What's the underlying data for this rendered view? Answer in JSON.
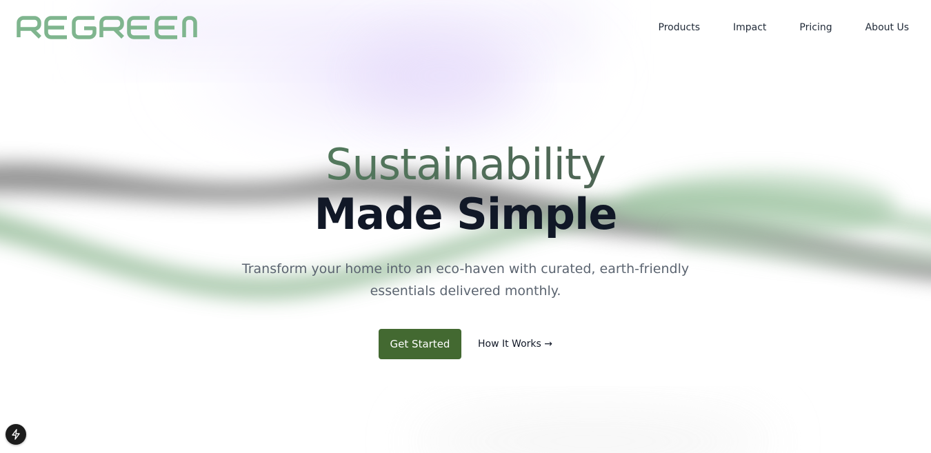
{
  "brand": {
    "name": "REGREEN",
    "logo_color": "#7fb58e"
  },
  "nav": {
    "items": [
      {
        "label": "Products"
      },
      {
        "label": "Impact"
      },
      {
        "label": "Pricing"
      },
      {
        "label": "About Us"
      }
    ]
  },
  "hero": {
    "headline_line1": "Sustainability",
    "headline_line2": "Made Simple",
    "subtitle": "Transform your home into an eco-haven with curated, earth-friendly essentials delivered monthly.",
    "primary_cta": "Get Started",
    "secondary_cta": "How It Works →"
  },
  "colors": {
    "accent": "#436931",
    "headline_gradient_start": "#5a9168",
    "headline_gradient_end": "#4a4f4c",
    "headline_dark": "#111827",
    "subtitle_text": "#5b6470"
  },
  "dev_badge": {
    "icon": "lightning-icon"
  }
}
